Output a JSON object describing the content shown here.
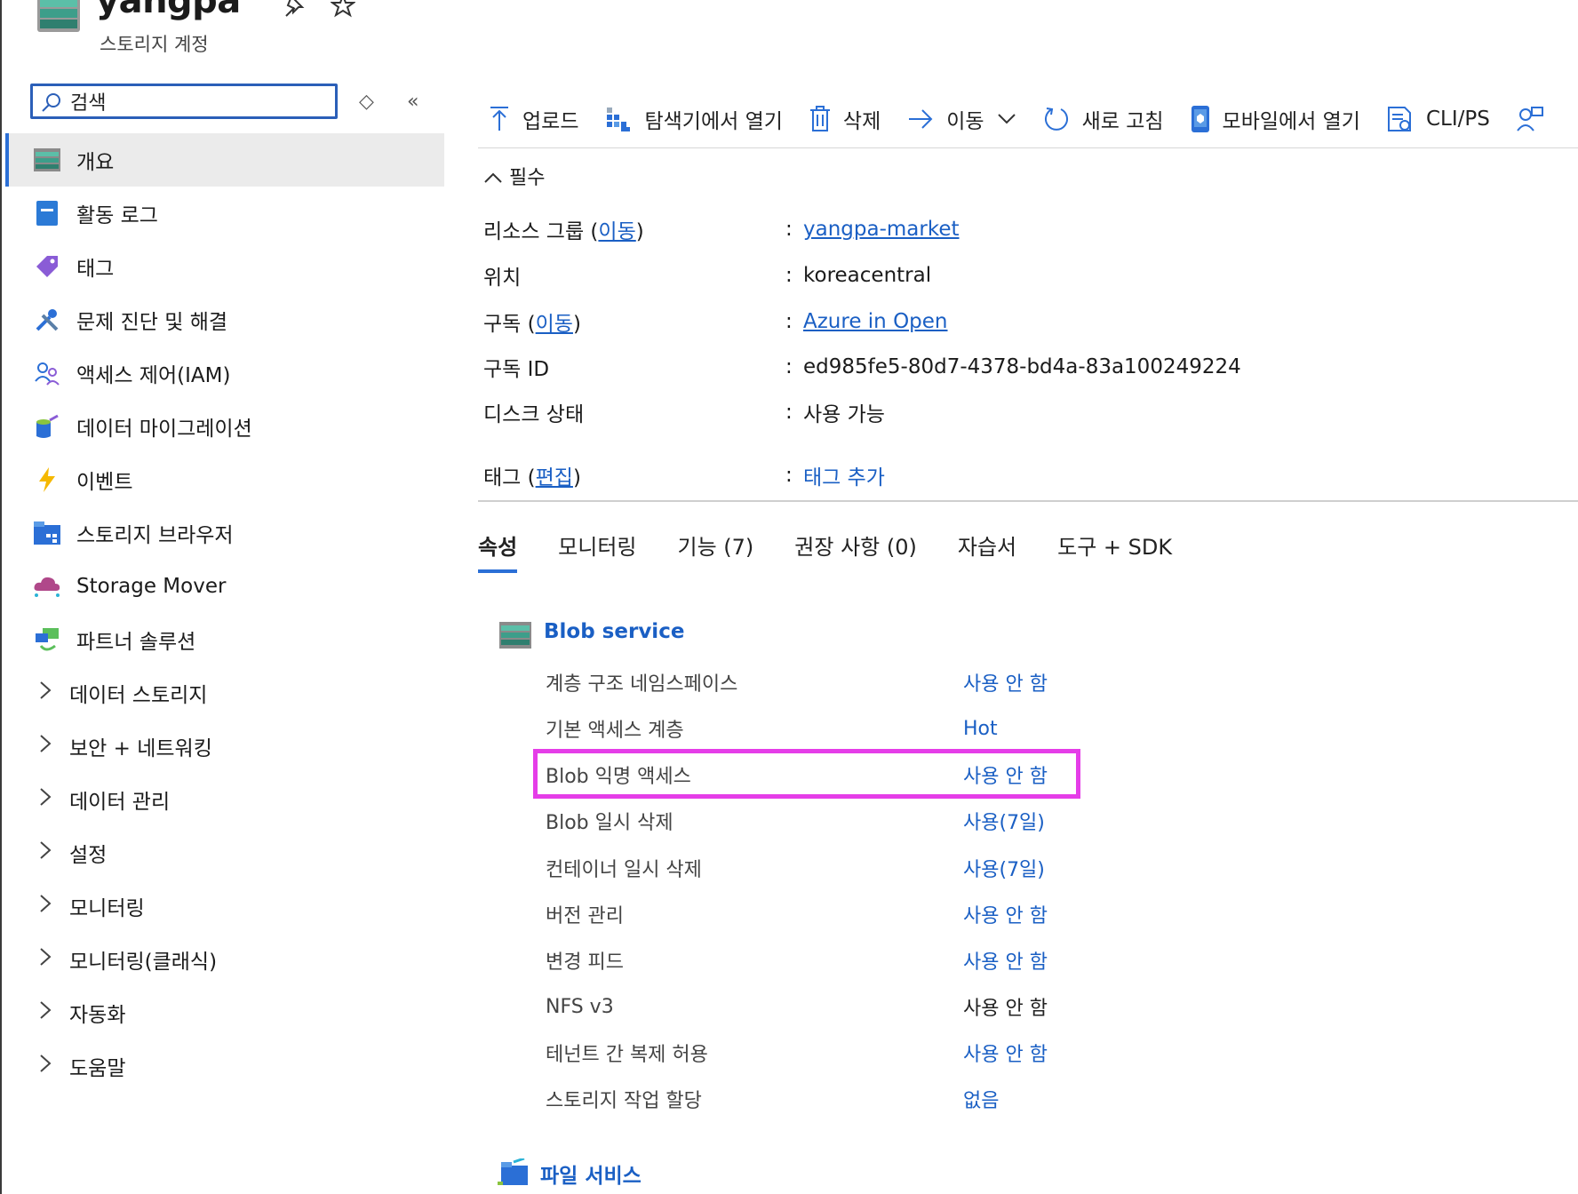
{
  "header": {
    "title": "yangpa",
    "subtitle": "스토리지 계정",
    "more_label": "···"
  },
  "search": {
    "value": "검색",
    "placeholder": ""
  },
  "sidebar": {
    "items": [
      {
        "label": "개요",
        "icon": "storage-account-icon",
        "active": true
      },
      {
        "label": "활동 로그",
        "icon": "activity-log-icon"
      },
      {
        "label": "태그",
        "icon": "tag-icon"
      },
      {
        "label": "문제 진단 및 해결",
        "icon": "tools-icon"
      },
      {
        "label": "액세스 제어(IAM)",
        "icon": "people-icon"
      },
      {
        "label": "데이터 마이그레이션",
        "icon": "data-migration-icon"
      },
      {
        "label": "이벤트",
        "icon": "lightning-icon"
      },
      {
        "label": "스토리지 브라우저",
        "icon": "storage-browser-icon"
      },
      {
        "label": "Storage Mover",
        "icon": "cloud-icon"
      },
      {
        "label": "파트너 솔루션",
        "icon": "partner-icon"
      },
      {
        "label": "데이터 스토리지",
        "icon": "chevron-right-icon"
      },
      {
        "label": "보안 + 네트워킹",
        "icon": "chevron-right-icon"
      },
      {
        "label": "데이터 관리",
        "icon": "chevron-right-icon"
      },
      {
        "label": "설정",
        "icon": "chevron-right-icon"
      },
      {
        "label": "모니터링",
        "icon": "chevron-right-icon"
      },
      {
        "label": "모니터링(클래식)",
        "icon": "chevron-right-icon"
      },
      {
        "label": "자동화",
        "icon": "chevron-right-icon"
      },
      {
        "label": "도움말",
        "icon": "chevron-right-icon"
      }
    ]
  },
  "toolbar": {
    "upload": "업로드",
    "open_explorer": "탐색기에서 열기",
    "delete": "삭제",
    "move": "이동",
    "refresh": "새로 고침",
    "open_mobile": "모바일에서 열기",
    "cli": "CLI/PS"
  },
  "essentials": {
    "heading": "필수",
    "resource_group_label": "리소스 그룹",
    "resource_group_move": "이동",
    "resource_group_value": "yangpa-market",
    "location_label": "위치",
    "location_value": "koreacentral",
    "subscription_label": "구독",
    "subscription_move": "이동",
    "subscription_value": "Azure in Open",
    "subscription_id_label": "구독 ID",
    "subscription_id_value": "ed985fe5-80d7-4378-bd4a-83a100249224",
    "disk_status_label": "디스크 상태",
    "disk_status_value": "사용 가능",
    "tags_label": "태그",
    "tags_edit": "편집",
    "tags_value": "태그 추가"
  },
  "tabs": [
    "속성",
    "모니터링",
    "기능 (7)",
    "권장 사항 (0)",
    "자습서",
    "도구 + SDK"
  ],
  "blob_service": {
    "title": "Blob service",
    "rows": [
      {
        "label": "계층 구조 네임스페이스",
        "value": "사용 안 함",
        "link": true
      },
      {
        "label": "기본 액세스 계층",
        "value": "Hot",
        "link": true
      },
      {
        "label": "Blob 익명 액세스",
        "value": "사용 안 함",
        "link": true
      },
      {
        "label": "Blob 일시 삭제",
        "value": "사용(7일)",
        "link": true
      },
      {
        "label": "컨테이너 일시 삭제",
        "value": "사용(7일)",
        "link": true
      },
      {
        "label": "버전 관리",
        "value": "사용 안 함",
        "link": true
      },
      {
        "label": "변경 피드",
        "value": "사용 안 함",
        "link": true
      },
      {
        "label": "NFS v3",
        "value": "사용 안 함",
        "link": false
      },
      {
        "label": "테넌트 간 복제 허용",
        "value": "사용 안 함",
        "link": true
      },
      {
        "label": "스토리지 작업 할당",
        "value": "없음",
        "link": true
      }
    ]
  },
  "file_service": {
    "title": "파일 서비스"
  },
  "colors": {
    "accent": "#2b6fd6",
    "link": "#1a5fc4",
    "highlight": "#e53de8"
  }
}
